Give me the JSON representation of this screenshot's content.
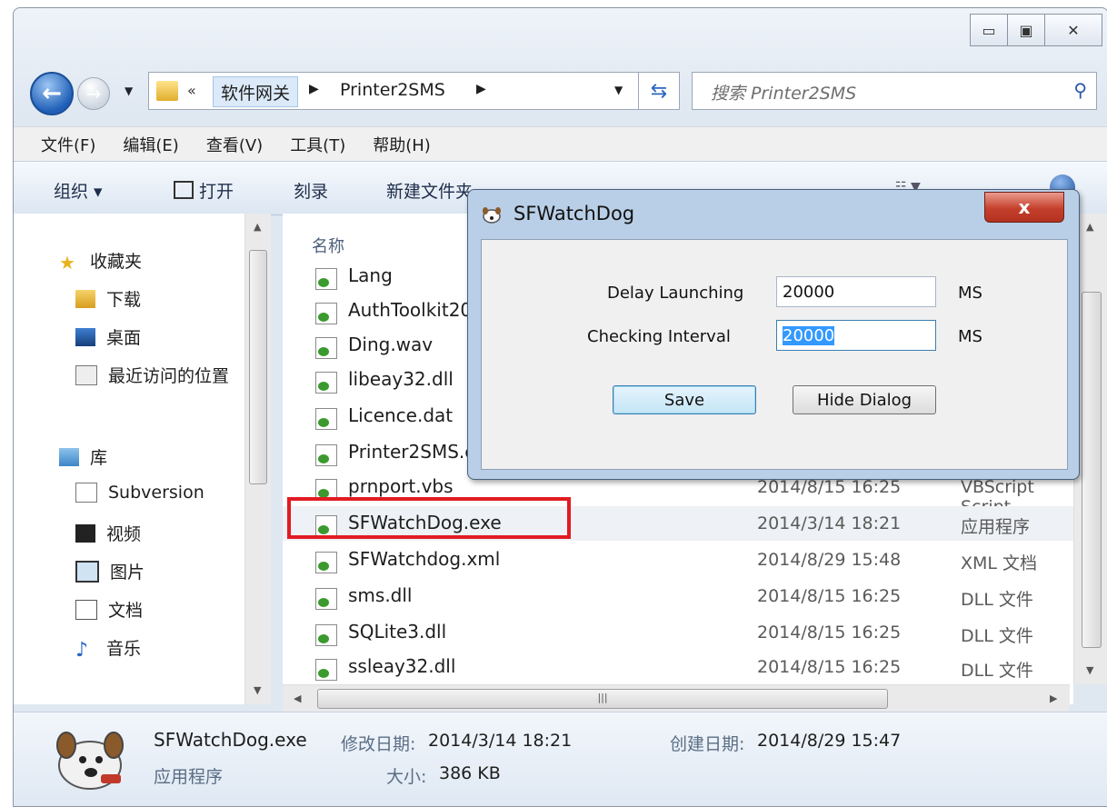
{
  "address": {
    "overflow": "«",
    "crumbs": [
      "软件网关",
      "Printer2SMS"
    ],
    "search_placeholder": "搜索 Printer2SMS"
  },
  "menu": [
    "文件(F)",
    "编辑(E)",
    "查看(V)",
    "工具(T)",
    "帮助(H)"
  ],
  "commands": {
    "organize": "组织 ▾",
    "open": "打开",
    "burn": "刻录",
    "new_folder": "新建文件夹"
  },
  "nav": {
    "favorites": "收藏夹",
    "downloads": "下载",
    "desktop": "桌面",
    "recent": "最近访问的位置",
    "libraries": "库",
    "subversion": "Subversion",
    "videos": "视频",
    "pictures": "图片",
    "documents": "文档",
    "music": "音乐"
  },
  "file_list": {
    "column_name": "名称",
    "files": [
      {
        "name": "Lang",
        "date": "",
        "type": ""
      },
      {
        "name": "AuthToolkit2012.dll",
        "date": "",
        "type": ""
      },
      {
        "name": "Ding.wav",
        "date": "",
        "type": ""
      },
      {
        "name": "libeay32.dll",
        "date": "",
        "type": ""
      },
      {
        "name": "Licence.dat",
        "date": "",
        "type": ""
      },
      {
        "name": "Printer2SMS.exe",
        "date": "",
        "type": ""
      },
      {
        "name": "prnport.vbs",
        "date": "2014/8/15 16:25",
        "type": "VBScript Script"
      },
      {
        "name": "SFWatchDog.exe",
        "date": "2014/3/14 18:21",
        "type": "应用程序"
      },
      {
        "name": "SFWatchdog.xml",
        "date": "2014/8/29 15:48",
        "type": "XML 文档"
      },
      {
        "name": "sms.dll",
        "date": "2014/8/15 16:25",
        "type": "DLL 文件"
      },
      {
        "name": "SQLite3.dll",
        "date": "2014/8/15 16:25",
        "type": "DLL 文件"
      },
      {
        "name": "ssleay32.dll",
        "date": "2014/8/15 16:25",
        "type": "DLL 文件"
      }
    ]
  },
  "details": {
    "filename": "SFWatchDog.exe",
    "modified_label": "修改日期:",
    "modified_value": "2014/3/14 18:21",
    "created_label": "创建日期:",
    "created_value": "2014/8/29 15:47",
    "type": "应用程序",
    "size_label": "大小:",
    "size_value": "386 KB"
  },
  "dialog": {
    "title": "SFWatchDog",
    "close": "x",
    "delay_label": "Delay Launching",
    "delay_value": "20000",
    "delay_unit": "MS",
    "interval_label": "Checking Interval",
    "interval_value": "20000",
    "interval_unit": "MS",
    "save": "Save",
    "hide": "Hide Dialog"
  },
  "colors": {
    "highlight": "#e11b22",
    "selection": "#3399ff"
  }
}
